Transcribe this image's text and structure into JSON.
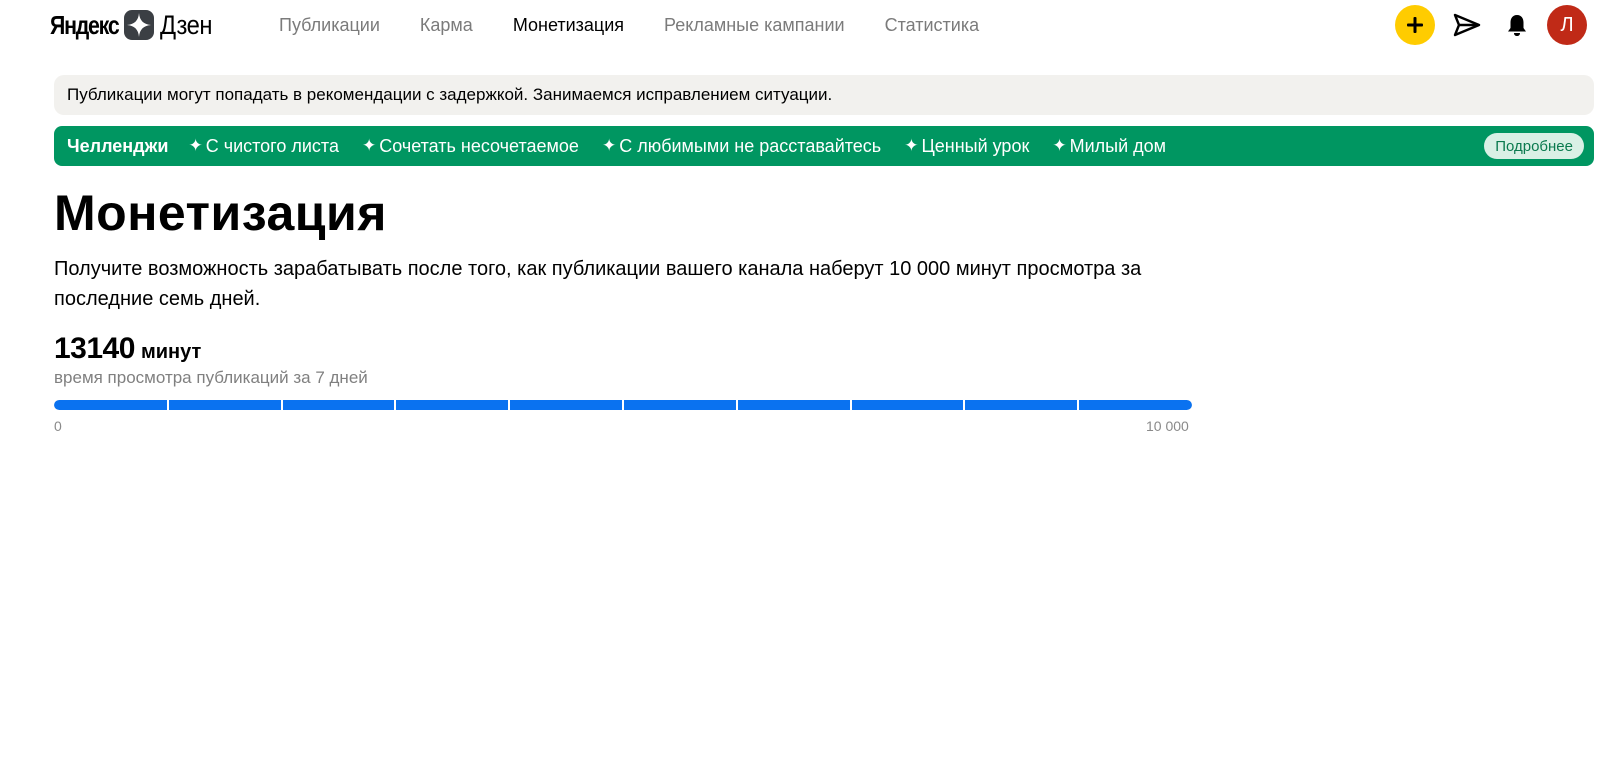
{
  "header": {
    "logo": {
      "yandex": "Яндекс",
      "dzen": "Дзен"
    },
    "nav": [
      {
        "label": "Публикации",
        "active": false
      },
      {
        "label": "Карма",
        "active": false
      },
      {
        "label": "Монетизация",
        "active": true
      },
      {
        "label": "Рекламные кампании",
        "active": false
      },
      {
        "label": "Статистика",
        "active": false
      }
    ],
    "actions": {
      "plus_icon": "plus-icon",
      "send_icon": "paper-plane-icon",
      "bell_icon": "bell-icon",
      "avatar_letter": "Л"
    },
    "colors": {
      "plus_bg": "#ffcc00",
      "avatar_bg": "#c02a17"
    }
  },
  "notice": {
    "text": "Публикации могут попадать в рекомендации с задержкой. Занимаемся исправлением ситуации."
  },
  "challenges": {
    "title": "Челленджи",
    "items": [
      "С чистого листа",
      "Сочетать несочетаемое",
      "С любимыми не расставайтесь",
      "Ценный урок",
      "Милый дом"
    ],
    "more_label": "Подробнее",
    "color": "#009661"
  },
  "main": {
    "title": "Монетизация",
    "description": "Получите возможность зарабатывать после того, как публикации вашего канала наберут 10 000 минут просмотра за последние семь дней.",
    "stat": {
      "value": "13140",
      "unit": "минут",
      "caption": "время просмотра публикаций за 7 дней"
    },
    "progress": {
      "current": 13140,
      "max": 10000,
      "segments": 10,
      "min_label": "0",
      "max_label": "10 000",
      "color": "#0a72f0"
    }
  }
}
